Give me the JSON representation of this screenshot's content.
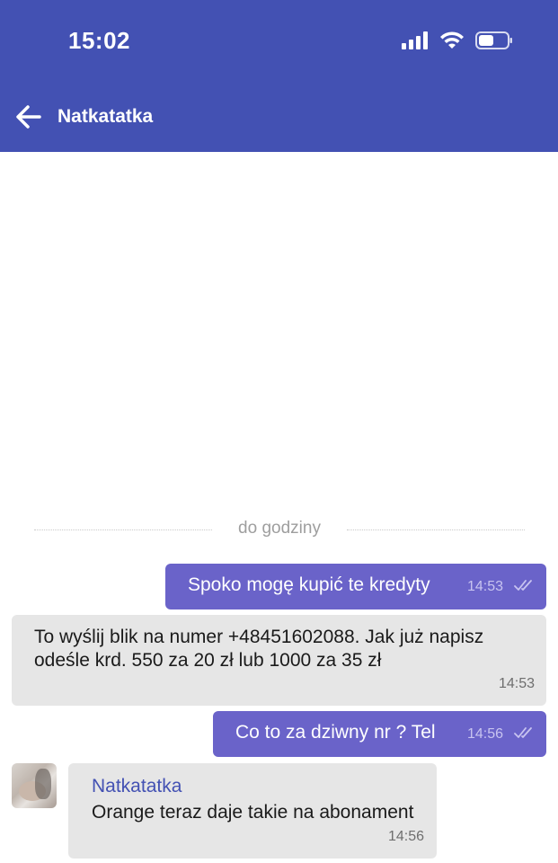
{
  "status_bar": {
    "time": "15:02",
    "icons": [
      "signal-icon",
      "wifi-icon",
      "battery-icon"
    ]
  },
  "header": {
    "title": "Natkatatka",
    "back_icon": "arrow-left-icon",
    "background": "#4351b3"
  },
  "divider": {
    "label": "do godziny"
  },
  "messages": [
    {
      "direction": "outgoing",
      "text": "Spoko mogę kupić te kredyty",
      "time": "14:53",
      "status_icon": "double-check-icon"
    },
    {
      "direction": "incoming",
      "lines": [
        "To wyślij blik na numer +48451602088. Jak już napisz",
        "odeśle krd. 550 za 20 zł lub 1000 za 35 zł"
      ],
      "time": "14:53"
    },
    {
      "direction": "outgoing",
      "text": "Co to za dziwny nr ? Tel",
      "time": "14:56",
      "status_icon": "double-check-icon"
    },
    {
      "direction": "incoming",
      "sender": "Natkatatka",
      "text": "Orange teraz daje takie na abonament",
      "time": "14:56"
    }
  ],
  "colors": {
    "outgoing_bubble": "#6a63c9",
    "incoming_bubble": "#e6e6e6",
    "sender_name": "#4351b3"
  }
}
